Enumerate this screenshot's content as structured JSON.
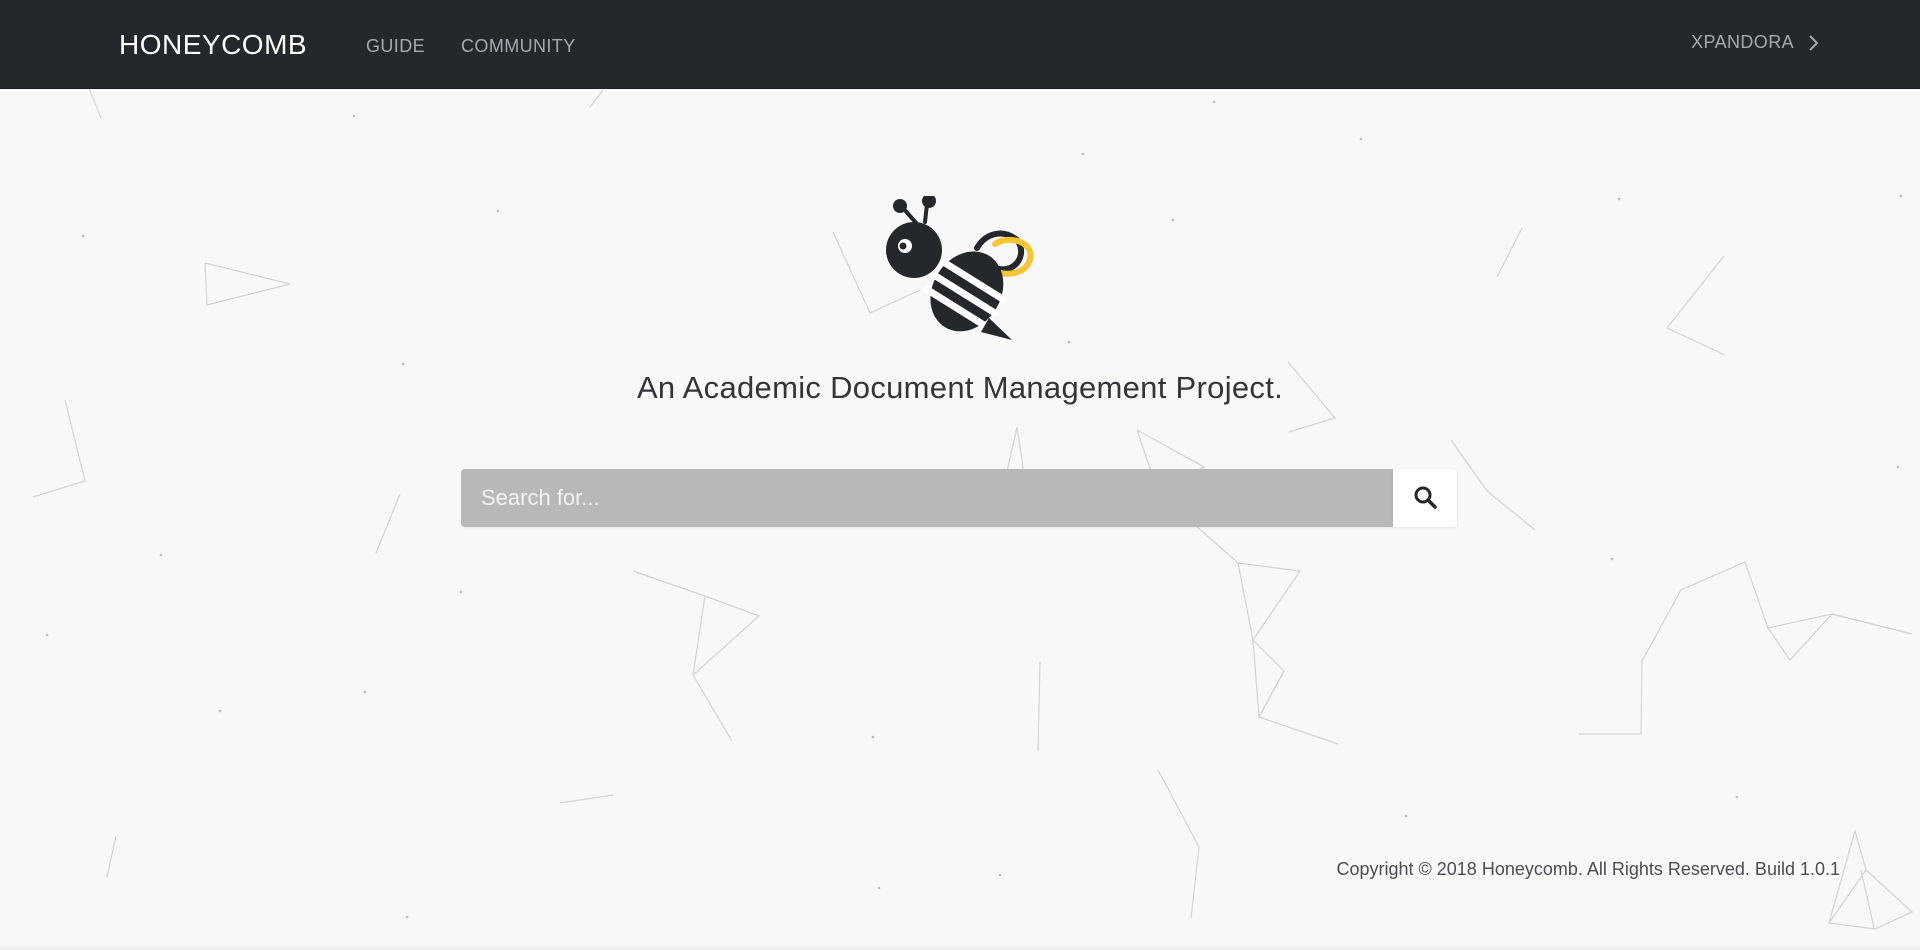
{
  "navbar": {
    "brand": "HONEYCOMB",
    "links": [
      {
        "label": "GUIDE"
      },
      {
        "label": "COMMUNITY"
      }
    ],
    "user": {
      "label": "XPANDORA",
      "icon": "chevron-right-icon"
    }
  },
  "hero": {
    "logo_icon": "bee-icon",
    "tagline": "An Academic Document Management Project.",
    "search": {
      "placeholder": "Search for...",
      "value": "",
      "button_icon": "search-icon"
    }
  },
  "footer": {
    "copyright": "Copyright © 2018 Honeycomb. All Rights Reserved. Build 1.0.1"
  },
  "colors": {
    "navbar_bg": "#24282d",
    "page_bg": "#f8f8f8",
    "search_bg": "#b7b8ba",
    "accent_yellow": "#f7c531",
    "bee_dark": "#24282d"
  }
}
